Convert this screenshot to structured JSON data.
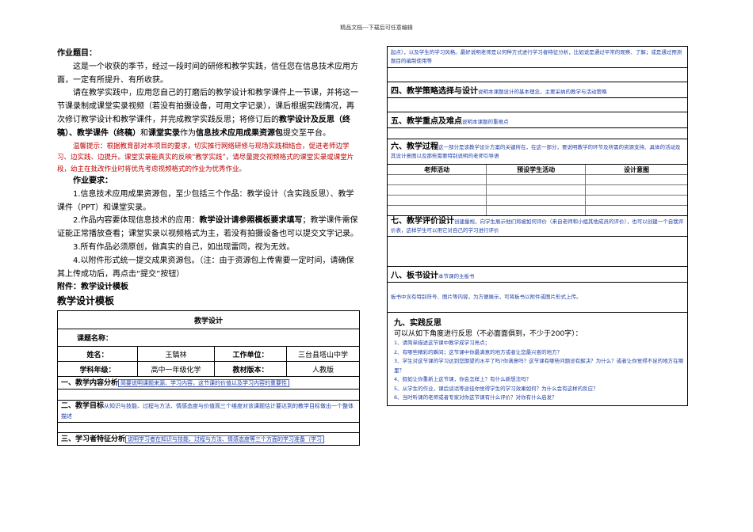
{
  "header": "精品文档---下载后可任意编辑",
  "left": {
    "task_title": "作业题目：",
    "p1": "这是一个收获的季节，经过一段时间的研修和教学实践，信任您在信息技术应用方面，一定有所提升、有所收获。",
    "p2a": "请在教学实践中，应用您自己的打磨后的教学设计和教学课件上一节课，并将这一节课录制成课堂实录视频（若没有拍摄设备，可用文字记录），课后根据实践情况，再次修订教学设计和教学课件，并完成教学实践反思；将修订后的",
    "p2b": "教学设计及反思（终稿）、教学课件（终稿）",
    "p2c": "和",
    "p2d": "课堂实录",
    "p2e": "作为",
    "p2f": "信息技术应用成果资源包",
    "p2g": "提交至平台。",
    "red": "温馨提示：根据教育部对本项目的要求，切实推行网络研修与现场实践相结合，促进老师边学习、边实践、边提升。课堂实录能真实的反映“教学实践”，请尽量提交视频格式的课堂实录或课堂片段，幼主在批改作业时将优先考虑视频格式的作业为优秀作业。",
    "req_title": "作业要求：",
    "req1": "1.信息技术应用成果资源包，至少包括三个作品：教学设计（含实践反思）、教学课件（PPT）和课堂实录。",
    "req2a": "2.作品内容要体现信息技术的应用：",
    "req2b": "教学设计请参照模板要求填写",
    "req2c": "；教学课件需保证能正常播放查看；课堂实录以视频格式为主，若没有拍摄设备也可以提交文字记录。",
    "req3": "3.所有作品必须原创，做真实的自己，如出现雷同，视为无效。",
    "req4": "4.以附件形式统一提交成果资源包。（注：由于资源包上传需要一定时间，请确保其上传成功后，再点击“提交”按钮）",
    "attach": "附件：教学设计模板",
    "template_title": "教学设计模板",
    "table": {
      "title": "教学设计",
      "course_label": "课题名称：",
      "name_label": "姓名：",
      "name": "王镐林",
      "unit_label": "工作单位：",
      "unit": "三台县塔山中学",
      "grade_label": "学科年级：",
      "grade": "高中一年级化学",
      "textbook_label": "教材版本：",
      "textbook": "人教版",
      "s1_title": "一、教学内容分析",
      "s1_note": "简要说明课题来源、学习内容，这节课的价值以及学习内容的重要性",
      "s2_title": "二、教学目标",
      "s2_note": "从知识与技能、过程与方法、情感态度与价值观三个维度对该课题估计要达到的教学目标做出一个整体描述",
      "s3_title": "三、学习者特征分析",
      "s3_note": "说明学习者在知识与技能、过程与方法、情感态度等三个方面的学习准备（学习"
    }
  },
  "right": {
    "cont_note": "起点），以及学生的学习风格。最好说明老师是以何种方式进行学习者特征分析，比如说是通过平常的观察、了解；或是通过预测题目的编制使用等",
    "s4_title": "四、教学策略选择与设计",
    "s4_note": "说明本课题设计的基本理念，主要采纳的教学与活动策略",
    "s5_title": "五、教学重点及难点",
    "s5_note": "说明本课题的重难点",
    "s6_title": "六、教学过程",
    "s6_note": "这一部分是该教学设计方案的关键所在，在这一部分，要说明教学的环节及所需的资源支持、具体的活动及其设计意图以及那些需要特别说明的老师引导语",
    "col1": "老师活动",
    "col2": "预设学生活动",
    "col3": "设计意图",
    "s7_title": "七、教学评价设计",
    "s7_note": "创建量规，向学生展示他们将被如何评价（来自老师和小组其他成员的评价），也可以创建一个自我评价表，这样学生可以用它对自己的学习进行评价",
    "s8_title": "八、板书设计",
    "s8_note": "本节课的主板书",
    "s8_body": "板书中含有特别符号、图片等内容，为方便展示，可将板书以附件或图片形式上传。",
    "s9_title": "九、实践反思",
    "s9_intro": "可以从如下角度进行反思（不必面面俱到，不少于200字）：",
    "q1": "1、请简单描述这节课中教学成学习亮点；",
    "q2": "2、有哪些精彩的瞬间；这节课中你最满意的地方或者让您最兴奋的地方？",
    "q3": "3、学生对这节课的学习达到您期望的水平了吗?你满意吗？这节课有哪些问题没有解决？为什么？或者让你觉得不足的地方在哪里？",
    "q4": "4、假如让你重新上这节课，你会怎样上？有什么新想法吗？",
    "q5": "5、从学生的作业，课后谈话等途径你觉得学生的学习效果如何？为什么会有这样的反应？",
    "q6": "6、当时听课的老师或者专家对你这节课有什么评价？对你有什么启发？"
  }
}
